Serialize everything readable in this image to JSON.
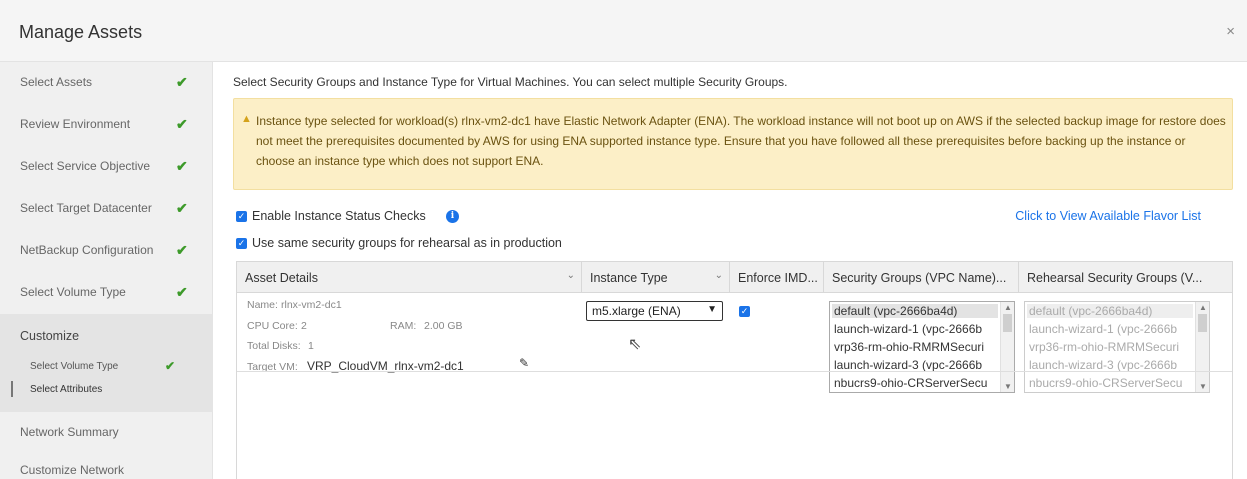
{
  "dialog": {
    "title": "Manage Assets",
    "close_glyph": "×"
  },
  "sidebar": {
    "items": [
      {
        "label": "Select Assets",
        "done": true
      },
      {
        "label": "Review Environment",
        "done": true
      },
      {
        "label": "Select Service Objective",
        "done": true
      },
      {
        "label": "Select Target Datacenter",
        "done": true
      },
      {
        "label": "NetBackup Configuration",
        "done": true
      },
      {
        "label": "Select Volume Type",
        "done": true
      }
    ],
    "active": {
      "label": "Customize",
      "subitems": [
        {
          "label": "Select Volume Type",
          "done": true
        },
        {
          "label": "Select Attributes",
          "done": false
        }
      ]
    },
    "after": [
      {
        "label": "Network Summary"
      },
      {
        "label": "Customize Network"
      }
    ],
    "check_glyph": "✔"
  },
  "main": {
    "intro": "Select Security Groups and Instance Type for Virtual Machines. You can select multiple Security Groups.",
    "warning": {
      "icon": "warning-triangle-icon",
      "text": "Instance type selected for workload(s) rlnx-vm2-dc1 have Elastic Network Adapter (ENA). The workload instance will not boot up on AWS if the selected backup image for restore does not meet the prerequisites documented by AWS for using ENA supported instance type. Ensure that you have followed all these prerequisites before backing up the instance or choose an instance type which does not support ENA."
    },
    "enable_status_checks": {
      "label": "Enable Instance Status Checks",
      "checked": true
    },
    "same_security_groups": {
      "label": "Use same security groups for rehearsal as in production",
      "checked": true
    },
    "flavor_link": "Click to View Available Flavor List",
    "grid": {
      "columns": [
        "Asset Details",
        "Instance Type",
        "Enforce IMD...",
        "Security Groups (VPC Name)...",
        "Rehearsal Security Groups (V..."
      ],
      "row": {
        "name_label": "Name:",
        "name": "rlnx-vm2-dc1",
        "cpu_label": "CPU Core:",
        "cpu": "2",
        "ram_label": "RAM:",
        "ram": "2.00 GB",
        "disks_label": "Total Disks:",
        "disks": "1",
        "target_label": "Target VM:",
        "target_vm": "VRP_CloudVM_rlnx-vm2-dc1",
        "instance_type": "m5.xlarge (ENA)",
        "enforce_imd": true,
        "security_groups": [
          "default (vpc-2666ba4d)",
          "launch-wizard-1 (vpc-2666b",
          "vrp36-rm-ohio-RMRMSecuri",
          "launch-wizard-3 (vpc-2666b",
          "nbucrs9-ohio-CRServerSecu"
        ],
        "rehearsal_security_groups": [
          "default (vpc-2666ba4d)",
          "launch-wizard-1 (vpc-2666b",
          "vrp36-rm-ohio-RMRMSecuri",
          "launch-wizard-3 (vpc-2666b",
          "nbucrs9-ohio-CRServerSecu"
        ]
      }
    }
  },
  "colors": {
    "accent": "#1a73e8",
    "check_green": "#3d9a2a",
    "warning_bg": "#fcefc7",
    "selected_option_bg": "#e3e3e3"
  }
}
